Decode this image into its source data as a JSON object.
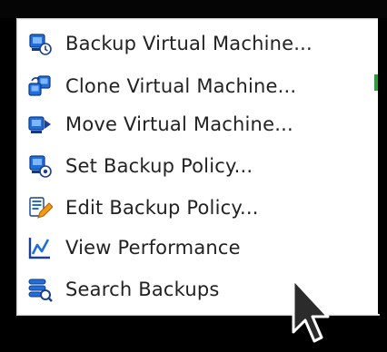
{
  "menu": {
    "items": [
      {
        "label": "Backup Virtual Machine...",
        "icon": "backup-vm-icon"
      },
      {
        "label": "Clone Virtual Machine...",
        "icon": "clone-vm-icon"
      },
      {
        "label": "Move Virtual Machine...",
        "icon": "move-vm-icon"
      },
      {
        "label": "Set Backup Policy...",
        "icon": "set-policy-icon"
      },
      {
        "label": "Edit Backup Policy...",
        "icon": "edit-policy-icon"
      },
      {
        "label": "View Performance",
        "icon": "performance-chart-icon"
      },
      {
        "label": "Search Backups",
        "icon": "search-backups-icon"
      }
    ]
  },
  "colors": {
    "icon_blue": "#1e6fd9",
    "icon_dark": "#1d3f8f",
    "text": "#222222",
    "menu_bg": "#ffffff"
  }
}
